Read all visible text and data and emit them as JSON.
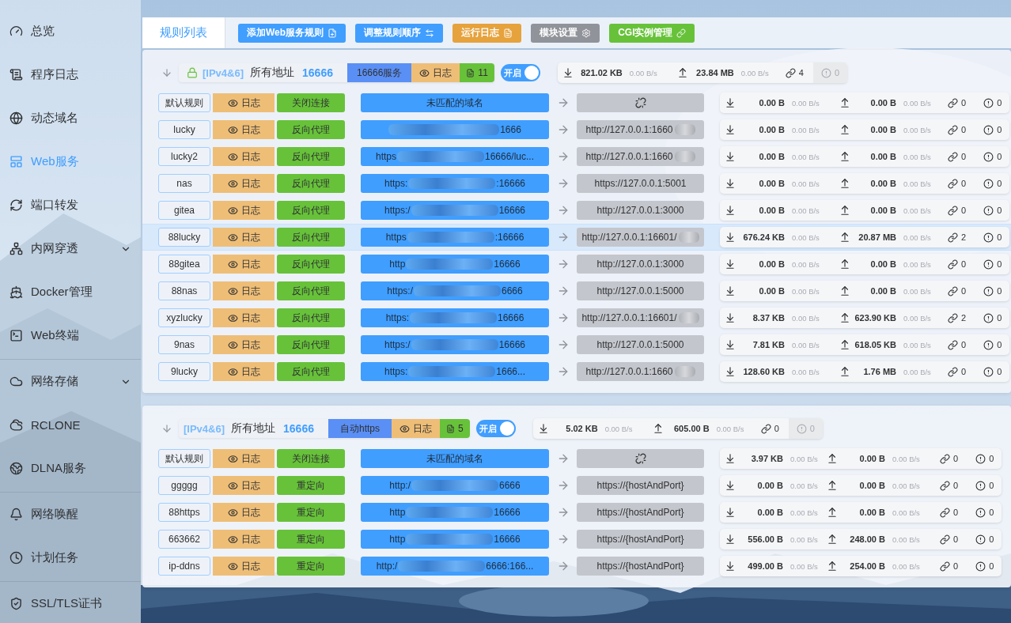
{
  "sidebar": {
    "sections": [
      [
        {
          "label": "总览",
          "selected": false,
          "expandable": false
        },
        {
          "label": "程序日志",
          "selected": false,
          "expandable": false
        },
        {
          "label": "动态域名",
          "selected": false,
          "expandable": false
        },
        {
          "label": "Web服务",
          "selected": true,
          "expandable": false
        },
        {
          "label": "端口转发",
          "selected": false,
          "expandable": false
        },
        {
          "label": "内网穿透",
          "selected": false,
          "expandable": true
        },
        {
          "label": "Docker管理",
          "selected": false,
          "expandable": false
        },
        {
          "label": "Web终端",
          "selected": false,
          "expandable": false
        }
      ],
      [
        {
          "label": "网络存储",
          "selected": false,
          "expandable": true
        },
        {
          "label": "RCLONE",
          "selected": false,
          "expandable": false
        },
        {
          "label": "DLNA服务",
          "selected": false,
          "expandable": false
        }
      ],
      [
        {
          "label": "网络唤醒",
          "selected": false,
          "expandable": false
        },
        {
          "label": "计划任务",
          "selected": false,
          "expandable": false
        }
      ],
      [
        {
          "label": "SSL/TLS证书",
          "selected": false,
          "expandable": false
        }
      ]
    ]
  },
  "tabs": [
    {
      "label": "规则列表",
      "selected": true
    }
  ],
  "toolbar": [
    {
      "label": "添加Web服务规则",
      "color": "#409eff"
    },
    {
      "label": "调整规则顺序",
      "color": "#409eff"
    },
    {
      "label": "运行日志",
      "color": "#e6a23c"
    },
    {
      "label": "模块设置",
      "color": "#909399"
    },
    {
      "label": "CGI实例管理",
      "color": "#67c23a"
    }
  ],
  "groups": [
    {
      "header": {
        "secure": true,
        "protocol": "[IPv4&6]",
        "address": "所有地址",
        "port": "16666",
        "service": "16666服务",
        "log": "日志",
        "count": "11",
        "toggle_label": "开启",
        "enabled": true,
        "stats": {
          "down": "821.02 KB",
          "down_rate": "0.00 B/s",
          "up": "23.84 MB",
          "up_rate": "0.00 B/s",
          "conns": "4",
          "errors": "0"
        }
      },
      "rows": [
        {
          "kind": "default",
          "name": "默认规则",
          "log": "日志",
          "action": "关闭连接",
          "front": "未匹配的域名",
          "selected": false,
          "stats": {
            "down": "0.00 B",
            "down_rate": "0.00 B/s",
            "up": "0.00 B",
            "up_rate": "0.00 B/s",
            "conns": "0",
            "errors": "0"
          }
        },
        {
          "kind": "rule",
          "name": "lucky",
          "log": "日志",
          "action": "反向代理",
          "front_suffix": "1666",
          "target": "http://127.0.0.1:1660",
          "target_masked": true,
          "selected": false,
          "stats": {
            "down": "0.00 B",
            "down_rate": "0.00 B/s",
            "up": "0.00 B",
            "up_rate": "0.00 B/s",
            "conns": "0",
            "errors": "0"
          }
        },
        {
          "kind": "rule",
          "name": "lucky2",
          "log": "日志",
          "action": "反向代理",
          "front_prefix": "https",
          "front_suffix": "16666/luc...",
          "target": "http://127.0.0.1:1660",
          "target_masked": true,
          "selected": false,
          "stats": {
            "down": "0.00 B",
            "down_rate": "0.00 B/s",
            "up": "0.00 B",
            "up_rate": "0.00 B/s",
            "conns": "0",
            "errors": "0"
          }
        },
        {
          "kind": "rule",
          "name": "nas",
          "log": "日志",
          "action": "反向代理",
          "front_prefix": "https:",
          "front_suffix": ":16666",
          "target": "https://127.0.0.1:5001",
          "target_masked": false,
          "selected": false,
          "stats": {
            "down": "0.00 B",
            "down_rate": "0.00 B/s",
            "up": "0.00 B",
            "up_rate": "0.00 B/s",
            "conns": "0",
            "errors": "0"
          }
        },
        {
          "kind": "rule",
          "name": "gitea",
          "log": "日志",
          "action": "反向代理",
          "front_prefix": "https:/",
          "front_suffix": "16666",
          "target": "http://127.0.0.1:3000",
          "target_masked": false,
          "selected": false,
          "stats": {
            "down": "0.00 B",
            "down_rate": "0.00 B/s",
            "up": "0.00 B",
            "up_rate": "0.00 B/s",
            "conns": "0",
            "errors": "0"
          }
        },
        {
          "kind": "rule",
          "name": "88lucky",
          "log": "日志",
          "action": "反向代理",
          "front_prefix": "https",
          "front_suffix": ":16666",
          "target": "http://127.0.0.1:16601/",
          "target_masked": true,
          "selected": true,
          "stats": {
            "down": "676.24 KB",
            "down_rate": "0.00 B/s",
            "up": "20.87 MB",
            "up_rate": "0.00 B/s",
            "conns": "2",
            "errors": "0"
          }
        },
        {
          "kind": "rule",
          "name": "88gitea",
          "log": "日志",
          "action": "反向代理",
          "front_prefix": "http",
          "front_suffix": "16666",
          "target": "http://127.0.0.1:3000",
          "target_masked": false,
          "selected": false,
          "stats": {
            "down": "0.00 B",
            "down_rate": "0.00 B/s",
            "up": "0.00 B",
            "up_rate": "0.00 B/s",
            "conns": "0",
            "errors": "0"
          }
        },
        {
          "kind": "rule",
          "name": "88nas",
          "log": "日志",
          "action": "反向代理",
          "front_prefix": "https:/",
          "front_suffix": "6666",
          "target": "http://127.0.0.1:5000",
          "target_masked": false,
          "selected": false,
          "stats": {
            "down": "0.00 B",
            "down_rate": "0.00 B/s",
            "up": "0.00 B",
            "up_rate": "0.00 B/s",
            "conns": "0",
            "errors": "0"
          }
        },
        {
          "kind": "rule",
          "name": "xyzlucky",
          "log": "日志",
          "action": "反向代理",
          "front_prefix": "https:",
          "front_suffix": "16666",
          "target": "http://127.0.0.1:16601/",
          "target_masked": true,
          "selected": false,
          "stats": {
            "down": "8.37 KB",
            "down_rate": "0.00 B/s",
            "up": "623.90 KB",
            "up_rate": "0.00 B/s",
            "conns": "2",
            "errors": "0"
          }
        },
        {
          "kind": "rule",
          "name": "9nas",
          "log": "日志",
          "action": "反向代理",
          "front_prefix": "https:/",
          "front_suffix": "16666",
          "target": "http://127.0.0.1:5000",
          "target_masked": false,
          "selected": false,
          "stats": {
            "down": "7.81 KB",
            "down_rate": "0.00 B/s",
            "up": "618.05 KB",
            "up_rate": "0.00 B/s",
            "conns": "0",
            "errors": "0"
          }
        },
        {
          "kind": "rule",
          "name": "9lucky",
          "log": "日志",
          "action": "反向代理",
          "front_prefix": "https:",
          "front_suffix": "1666...",
          "target": "http://127.0.0.1:1660",
          "target_masked": true,
          "selected": false,
          "stats": {
            "down": "128.60 KB",
            "down_rate": "0.00 B/s",
            "up": "1.76 MB",
            "up_rate": "0.00 B/s",
            "conns": "0",
            "errors": "0"
          }
        }
      ]
    },
    {
      "header": {
        "secure": false,
        "protocol": "[IPv4&6]",
        "address": "所有地址",
        "port": "16666",
        "service": "自动https",
        "log": "日志",
        "count": "5",
        "toggle_label": "开启",
        "enabled": true,
        "stats": {
          "down": "5.02 KB",
          "down_rate": "0.00 B/s",
          "up": "605.00 B",
          "up_rate": "0.00 B/s",
          "conns": "0",
          "errors": "0"
        }
      },
      "rows": [
        {
          "kind": "default",
          "name": "默认规则",
          "log": "日志",
          "action": "关闭连接",
          "front": "未匹配的域名",
          "selected": false,
          "stats": {
            "down": "3.97 KB",
            "down_rate": "0.00 B/s",
            "up": "0.00 B",
            "up_rate": "0.00 B/s",
            "conns": "0",
            "errors": "0"
          }
        },
        {
          "kind": "rule",
          "name": "ggggg",
          "log": "日志",
          "action": "重定向",
          "front_prefix": "http:/",
          "front_suffix": "6666",
          "target": "https://{hostAndPort}",
          "target_masked": false,
          "selected": false,
          "stats": {
            "down": "0.00 B",
            "down_rate": "0.00 B/s",
            "up": "0.00 B",
            "up_rate": "0.00 B/s",
            "conns": "0",
            "errors": "0"
          }
        },
        {
          "kind": "rule",
          "name": "88https",
          "log": "日志",
          "action": "重定向",
          "front_prefix": "http",
          "front_suffix": "16666",
          "target": "https://{hostAndPort}",
          "target_masked": false,
          "selected": false,
          "stats": {
            "down": "0.00 B",
            "down_rate": "0.00 B/s",
            "up": "0.00 B",
            "up_rate": "0.00 B/s",
            "conns": "0",
            "errors": "0"
          }
        },
        {
          "kind": "rule",
          "name": "663662",
          "log": "日志",
          "action": "重定向",
          "front_prefix": "http",
          "front_suffix": "16666",
          "target": "https://{hostAndPort}",
          "target_masked": false,
          "selected": false,
          "stats": {
            "down": "556.00 B",
            "down_rate": "0.00 B/s",
            "up": "248.00 B",
            "up_rate": "0.00 B/s",
            "conns": "0",
            "errors": "0"
          }
        },
        {
          "kind": "rule",
          "name": "ip-ddns",
          "log": "日志",
          "action": "重定向",
          "front_prefix": "http:/",
          "front_suffix": "6666:166...",
          "target": "https://{hostAndPort}",
          "target_masked": false,
          "selected": false,
          "stats": {
            "down": "499.00 B",
            "down_rate": "0.00 B/s",
            "up": "254.00 B",
            "up_rate": "0.00 B/s",
            "conns": "0",
            "errors": "0"
          }
        }
      ]
    }
  ]
}
